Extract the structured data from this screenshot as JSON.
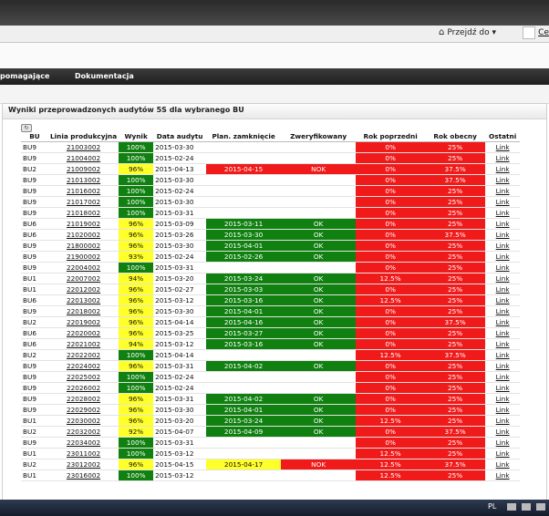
{
  "header": {
    "goto_label": "Przejdź do ▾",
    "user_label": "Ce"
  },
  "menu": {
    "items": [
      "pomagające",
      "Dokumentacja"
    ]
  },
  "panel": {
    "title": "Wyniki przeprowadzonych audytów 5S dla wybranego BU"
  },
  "columns": [
    "BU",
    "Linia produkcyjna",
    "Wynik",
    "Data audytu",
    "Plan. zamknięcie",
    "Zweryfikowany",
    "Rok poprzedni",
    "Rok obecny",
    "Ostatni"
  ],
  "rows": [
    [
      "BU9",
      "21003002",
      "100%",
      "2015-03-30",
      "",
      "",
      "0%",
      "25%",
      "Link"
    ],
    [
      "BU9",
      "21004002",
      "100%",
      "2015-02-24",
      "",
      "",
      "0%",
      "25%",
      "Link"
    ],
    [
      "BU2",
      "21009002",
      "96%",
      "2015-04-13",
      "2015-04-15",
      "NOK",
      "0%",
      "37.5%",
      "Link"
    ],
    [
      "BU9",
      "21013002",
      "100%",
      "2015-03-30",
      "",
      "",
      "0%",
      "37.5%",
      "Link"
    ],
    [
      "BU9",
      "21016002",
      "100%",
      "2015-02-24",
      "",
      "",
      "0%",
      "25%",
      "Link"
    ],
    [
      "BU9",
      "21017002",
      "100%",
      "2015-03-30",
      "",
      "",
      "0%",
      "25%",
      "Link"
    ],
    [
      "BU9",
      "21018002",
      "100%",
      "2015-03-31",
      "",
      "",
      "0%",
      "25%",
      "Link"
    ],
    [
      "BU6",
      "21019002",
      "96%",
      "2015-03-09",
      "2015-03-11",
      "OK",
      "0%",
      "25%",
      "Link"
    ],
    [
      "BU6",
      "21020002",
      "96%",
      "2015-03-26",
      "2015-03-30",
      "OK",
      "0%",
      "37.5%",
      "Link"
    ],
    [
      "BU9",
      "21800002",
      "96%",
      "2015-03-30",
      "2015-04-01",
      "OK",
      "0%",
      "25%",
      "Link"
    ],
    [
      "BU9",
      "21900002",
      "93%",
      "2015-02-24",
      "2015-02-26",
      "OK",
      "0%",
      "25%",
      "Link"
    ],
    [
      "BU9",
      "22004002",
      "100%",
      "2015-03-31",
      "",
      "",
      "0%",
      "25%",
      "Link"
    ],
    [
      "BU1",
      "22007002",
      "94%",
      "2015-03-20",
      "2015-03-24",
      "OK",
      "12.5%",
      "25%",
      "Link"
    ],
    [
      "BU1",
      "22012002",
      "96%",
      "2015-02-27",
      "2015-03-03",
      "OK",
      "0%",
      "25%",
      "Link"
    ],
    [
      "BU6",
      "22013002",
      "96%",
      "2015-03-12",
      "2015-03-16",
      "OK",
      "12.5%",
      "25%",
      "Link"
    ],
    [
      "BU9",
      "22018002",
      "96%",
      "2015-03-30",
      "2015-04-01",
      "OK",
      "0%",
      "25%",
      "Link"
    ],
    [
      "BU2",
      "22019002",
      "96%",
      "2015-04-14",
      "2015-04-16",
      "OK",
      "0%",
      "37.5%",
      "Link"
    ],
    [
      "BU6",
      "22020002",
      "96%",
      "2015-03-25",
      "2015-03-27",
      "OK",
      "0%",
      "25%",
      "Link"
    ],
    [
      "BU6",
      "22021002",
      "94%",
      "2015-03-12",
      "2015-03-16",
      "OK",
      "0%",
      "25%",
      "Link"
    ],
    [
      "BU2",
      "22022002",
      "100%",
      "2015-04-14",
      "",
      "",
      "12.5%",
      "37.5%",
      "Link"
    ],
    [
      "BU9",
      "22024002",
      "96%",
      "2015-03-31",
      "2015-04-02",
      "OK",
      "0%",
      "25%",
      "Link"
    ],
    [
      "BU9",
      "22025002",
      "100%",
      "2015-02-24",
      "",
      "",
      "0%",
      "25%",
      "Link"
    ],
    [
      "BU9",
      "22026002",
      "100%",
      "2015-02-24",
      "",
      "",
      "0%",
      "25%",
      "Link"
    ],
    [
      "BU9",
      "22028002",
      "96%",
      "2015-03-31",
      "2015-04-02",
      "OK",
      "0%",
      "25%",
      "Link"
    ],
    [
      "BU9",
      "22029002",
      "96%",
      "2015-03-30",
      "2015-04-01",
      "OK",
      "0%",
      "25%",
      "Link"
    ],
    [
      "BU1",
      "22030002",
      "96%",
      "2015-03-20",
      "2015-03-24",
      "OK",
      "12.5%",
      "25%",
      "Link"
    ],
    [
      "BU2",
      "22032002",
      "92%",
      "2015-04-07",
      "2015-04-09",
      "OK",
      "0%",
      "37.5%",
      "Link"
    ],
    [
      "BU9",
      "22034002",
      "100%",
      "2015-03-31",
      "",
      "",
      "0%",
      "25%",
      "Link"
    ],
    [
      "BU1",
      "23011002",
      "100%",
      "2015-03-12",
      "",
      "",
      "12.5%",
      "25%",
      "Link"
    ],
    [
      "BU2",
      "23012002",
      "96%",
      "2015-04-15",
      "2015-04-17",
      "NOK",
      "12.5%",
      "37.5%",
      "Link"
    ],
    [
      "BU1",
      "23016002",
      "100%",
      "2015-03-12",
      "",
      "",
      "12.5%",
      "25%",
      "Link"
    ]
  ],
  "taskbar": {
    "lang": "PL"
  }
}
